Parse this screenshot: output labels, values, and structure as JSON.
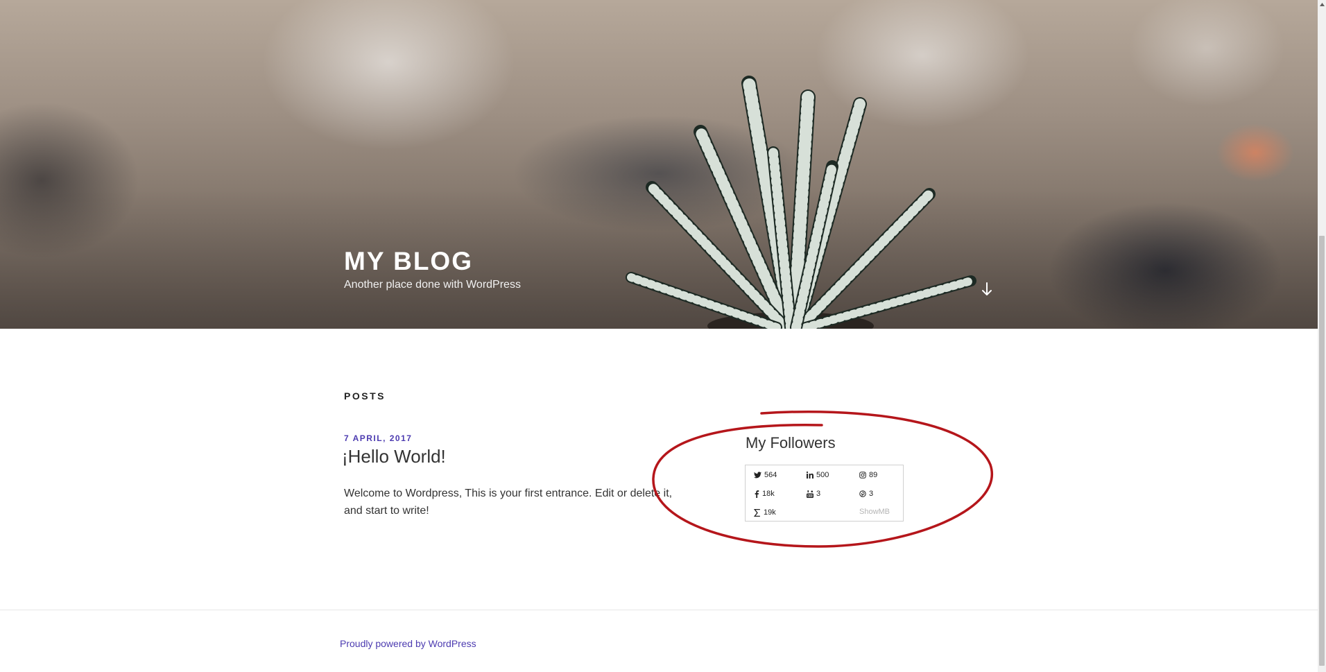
{
  "header": {
    "site_title": "MY BLOG",
    "site_description": "Another place done with WordPress",
    "scroll_icon": "arrow-down-icon"
  },
  "main": {
    "section_heading": "POSTS",
    "post": {
      "date": "7 APRIL, 2017",
      "title": "¡Hello World!",
      "excerpt": "Welcome to Wordpress, This is your first entrance. Edit or delete it, and start to write!"
    }
  },
  "sidebar": {
    "widget_title": "My Followers",
    "followers": [
      {
        "network": "twitter",
        "icon": "twitter-icon",
        "count": "564"
      },
      {
        "network": "linkedin",
        "icon": "linkedin-icon",
        "count": "500"
      },
      {
        "network": "instagram",
        "icon": "instagram-icon",
        "count": "89"
      },
      {
        "network": "facebook",
        "icon": "facebook-icon",
        "count": "18k"
      },
      {
        "network": "youtube",
        "icon": "youtube-icon",
        "count": "3"
      },
      {
        "network": "pinterest",
        "icon": "pinterest-icon",
        "count": "3"
      },
      {
        "network": "total",
        "icon": "sigma-icon",
        "count": "19k"
      }
    ],
    "brand": "ShowMB"
  },
  "footer": {
    "credit": "Proudly powered by WordPress"
  },
  "colors": {
    "accent": "#4c3bb0",
    "annotation": "#b5161b"
  }
}
